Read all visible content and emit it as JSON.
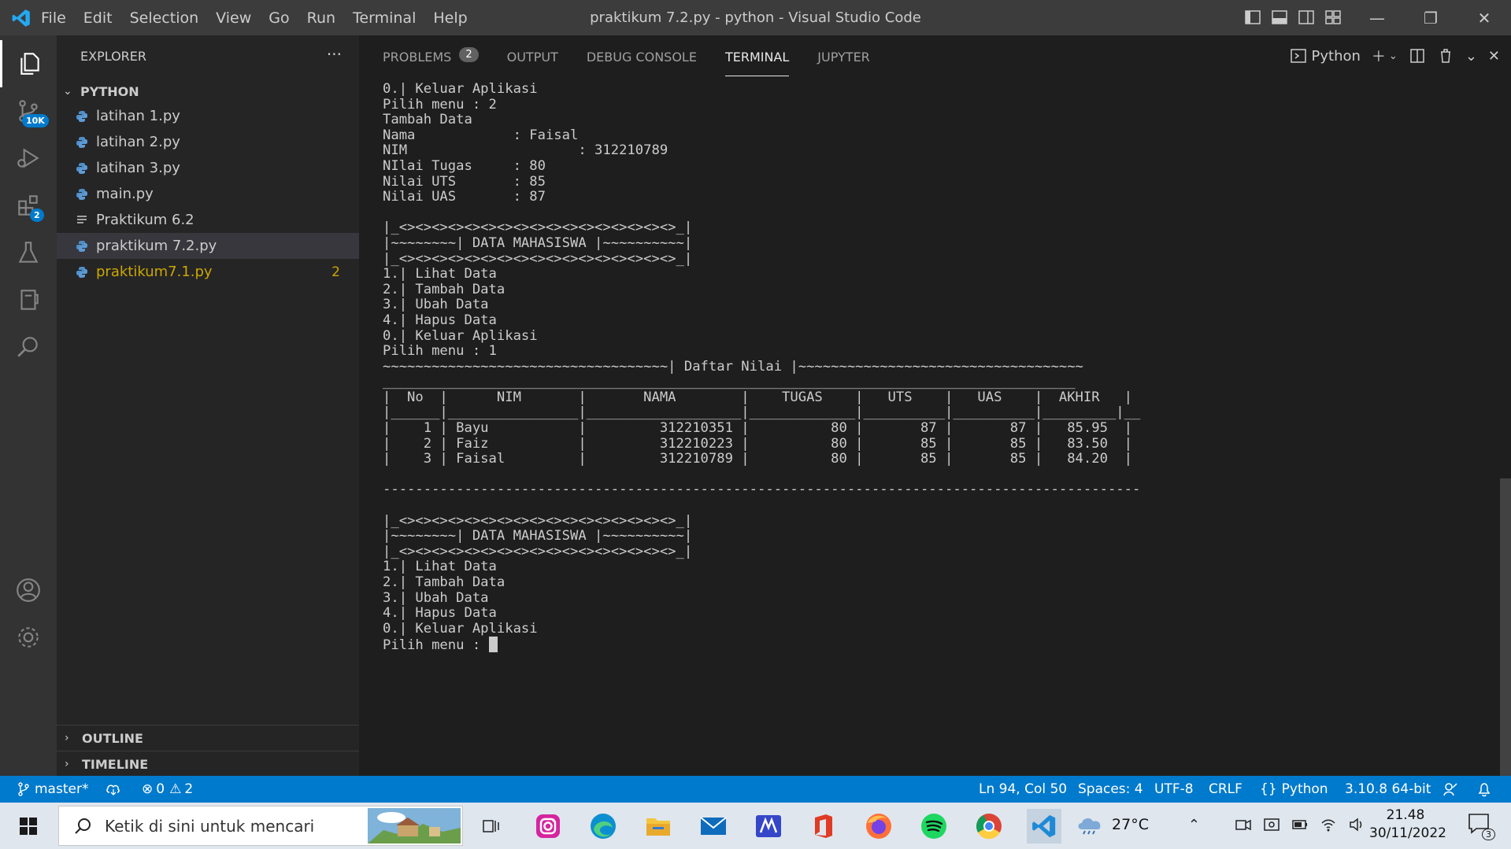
{
  "titlebar": {
    "menu": [
      "File",
      "Edit",
      "Selection",
      "View",
      "Go",
      "Run",
      "Terminal",
      "Help"
    ],
    "title": "praktikum 7.2.py - python - Visual Studio Code"
  },
  "activity": {
    "scm_badge": "10K",
    "ext_badge": "2"
  },
  "sidebar": {
    "header": "EXPLORER",
    "more": "···",
    "folder": "PYTHON",
    "files": [
      {
        "name": "latihan 1.py"
      },
      {
        "name": "latihan 2.py"
      },
      {
        "name": "latihan 3.py"
      },
      {
        "name": "main.py"
      },
      {
        "name": "Praktikum 6.2"
      },
      {
        "name": "praktikum 7.2.py"
      },
      {
        "name": "praktikum7.1.py",
        "count": "2"
      }
    ],
    "outline": "OUTLINE",
    "timeline": "TIMELINE"
  },
  "panel": {
    "tabs": [
      "PROBLEMS",
      "OUTPUT",
      "DEBUG CONSOLE",
      "TERMINAL",
      "JUPYTER"
    ],
    "problems_count": "2",
    "active_tab": "TERMINAL",
    "shell": "Python"
  },
  "terminal": {
    "lines": [
      "0.| Keluar Aplikasi",
      "Pilih menu : 2",
      "Tambah Data",
      "Nama            : Faisal",
      "NIM                     : 312210789",
      "NIlai Tugas     : 80",
      "Nilai UTS       : 85",
      "Nilai UAS       : 87",
      "",
      "|_<><><><><><><><><><><><><><><><><>_|",
      "|~~~~~~~~| DATA MAHASISWA |~~~~~~~~~~|",
      "|_<><><><><><><><><><><><><><><><><>_|",
      "1.| Lihat Data",
      "2.| Tambah Data",
      "3.| Ubah Data",
      "4.| Hapus Data",
      "0.| Keluar Aplikasi",
      "Pilih menu : 1",
      "~~~~~~~~~~~~~~~~~~~~~~~~~~~~~~~~~~~| Daftar Nilai |~~~~~~~~~~~~~~~~~~~~~~~~~~~~~~~~~~~",
      "_____________________________________________________________________________________",
      "|  No  |      NIM       |       NAMA        |    TUGAS    |   UTS    |   UAS    |  AKHIR   |",
      "|______|________________|___________________|_____________|__________|__________|_________|__",
      "|    1 | Bayu           |         312210351 |          80 |       87 |       87 |   85.95  |",
      "|    2 | Faiz           |         312210223 |          80 |       85 |       85 |   83.50  |",
      "|    3 | Faisal         |         312210789 |          80 |       85 |       85 |   84.20  |",
      "",
      "---------------------------------------------------------------------------------------------",
      "",
      "|_<><><><><><><><><><><><><><><><><>_|",
      "|~~~~~~~~| DATA MAHASISWA |~~~~~~~~~~|",
      "|_<><><><><><><><><><><><><><><><><>_|",
      "1.| Lihat Data",
      "2.| Tambah Data",
      "3.| Ubah Data",
      "4.| Hapus Data",
      "0.| Keluar Aplikasi",
      "Pilih menu : "
    ]
  },
  "statusbar": {
    "branch": "master*",
    "errors": "0",
    "warnings": "2",
    "position": "Ln 94, Col 50",
    "spaces": "Spaces: 4",
    "encoding": "UTF-8",
    "eol": "CRLF",
    "language": "Python",
    "interpreter": "3.10.8 64-bit"
  },
  "taskbar": {
    "search_placeholder": "Ketik di sini untuk mencari",
    "temperature": "27°C",
    "time": "21.48",
    "date": "30/11/2022",
    "notifications": "3"
  },
  "colors": {
    "accent": "#007acc",
    "warning": "#cca700",
    "editor_bg": "#1e1e1e",
    "sidebar_bg": "#252526"
  }
}
